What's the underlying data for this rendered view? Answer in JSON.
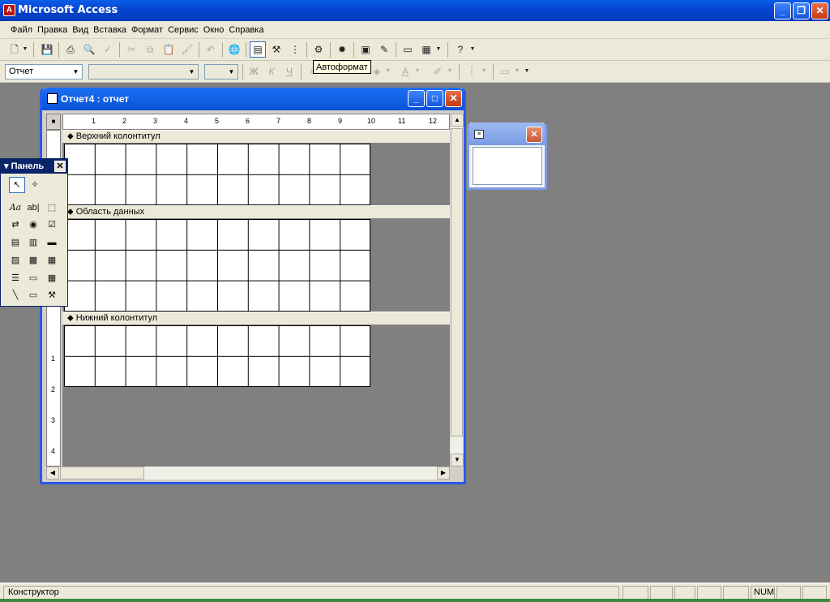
{
  "app": {
    "title": "Microsoft Access",
    "icon_label": "A"
  },
  "window_controls": {
    "minimize": "_",
    "maximize": "□",
    "restore": "❐",
    "close": "✕"
  },
  "menu": [
    "Файл",
    "Правка",
    "Вид",
    "Вставка",
    "Формат",
    "Сервис",
    "Окно",
    "Справка"
  ],
  "format_toolbar": {
    "object_combo": "Отчет",
    "bold": "Ж",
    "italic": "К",
    "underline": "Ч"
  },
  "tooltip": "Автоформат",
  "report_window": {
    "title": "Отчет4 : отчет",
    "ruler_h": [
      "1",
      "2",
      "3",
      "4",
      "5",
      "6",
      "7",
      "8",
      "9",
      "10",
      "11",
      "12"
    ],
    "ruler_v": [
      "1",
      "2",
      "3",
      "4"
    ],
    "sections": {
      "header": "Верхний колонтитул",
      "detail": "Область данных",
      "footer": "Нижний колонтитул"
    }
  },
  "toolbox": {
    "title": "Панель",
    "label_tool": "Aa",
    "textbox_tool": "ab|"
  },
  "status": {
    "text": "Конструктор",
    "num": "NUM"
  }
}
